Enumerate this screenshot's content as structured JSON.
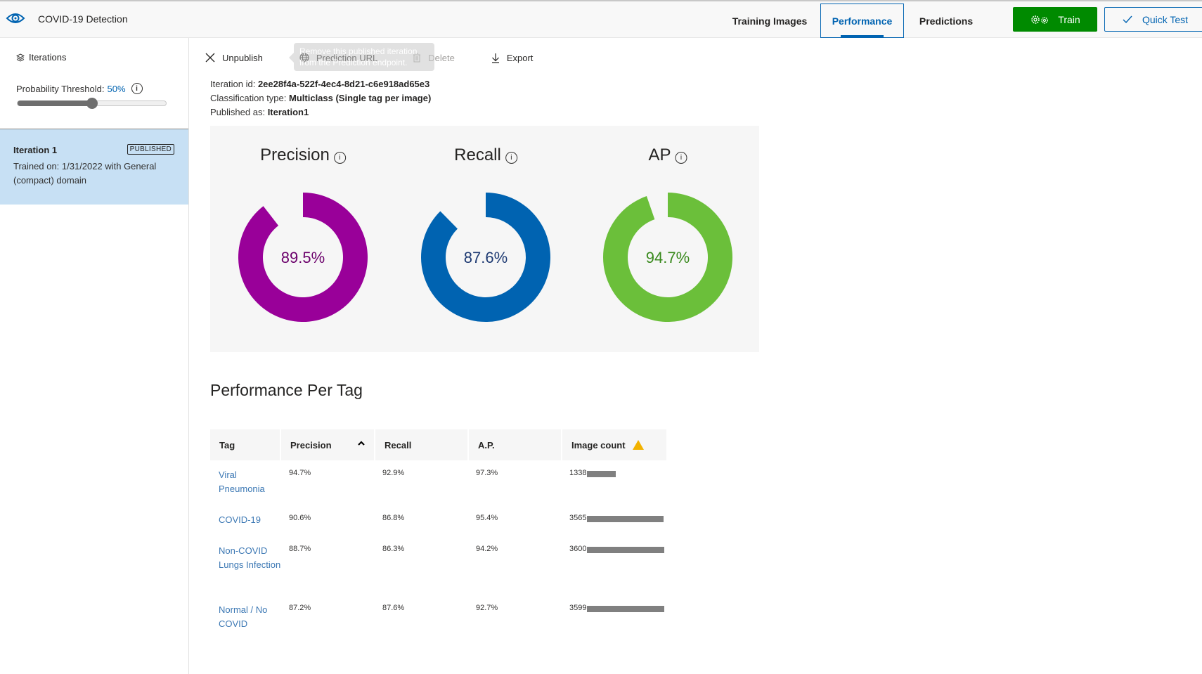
{
  "header": {
    "app_title": "COVID-19 Detection",
    "tabs": [
      {
        "label": "Training Images",
        "active": false
      },
      {
        "label": "Performance",
        "active": true
      },
      {
        "label": "Predictions",
        "active": false
      }
    ],
    "train_label": "Train",
    "quick_test_label": "Quick Test"
  },
  "sidebar": {
    "iterations_label": "Iterations",
    "threshold_label": "Probability Threshold:",
    "threshold_value": "50%",
    "threshold_fraction": 0.5,
    "iterations": [
      {
        "name": "Iteration 1",
        "badge": "PUBLISHED",
        "description": "Trained on: 1/31/2022 with General (compact) domain",
        "selected": true
      }
    ]
  },
  "toolbar": {
    "unpublish_label": "Unpublish",
    "prediction_url_label": "Prediction URL",
    "delete_label": "Delete",
    "export_label": "Export",
    "tooltip": "Remove this published iteration from the Prediction endpoint."
  },
  "meta": {
    "iteration_id_label": "Iteration id:",
    "iteration_id": "2ee28f4a-522f-4ec4-8d21-c6e918ad65e3",
    "classification_label": "Classification type:",
    "classification": "Multiclass (Single tag per image)",
    "published_label": "Published as:",
    "published": "Iteration1"
  },
  "metrics": [
    {
      "title": "Precision",
      "value": 89.5,
      "display": "89.5%",
      "color": "#990099",
      "text_color": "#6b006b"
    },
    {
      "title": "Recall",
      "value": 87.6,
      "display": "87.6%",
      "color": "#0063b1",
      "text_color": "#1f3b73"
    },
    {
      "title": "AP",
      "value": 94.7,
      "display": "94.7%",
      "color": "#6bbf3a",
      "text_color": "#3a8a1e"
    }
  ],
  "table": {
    "title": "Performance Per Tag",
    "columns": [
      "Tag",
      "Precision",
      "Recall",
      "A.P.",
      "Image count"
    ],
    "max_count": 3600,
    "rows": [
      {
        "tag": "Viral Pneumonia",
        "precision": "94.7%",
        "recall": "92.9%",
        "ap": "97.3%",
        "count": 1338
      },
      {
        "tag": "COVID-19",
        "precision": "90.6%",
        "recall": "86.8%",
        "ap": "95.4%",
        "count": 3565
      },
      {
        "tag": "Non-COVID Lungs Infection",
        "precision": "88.7%",
        "recall": "86.3%",
        "ap": "94.2%",
        "count": 3600
      },
      {
        "tag": "Normal / No COVID",
        "precision": "87.2%",
        "recall": "87.6%",
        "ap": "92.7%",
        "count": 3599
      }
    ]
  }
}
